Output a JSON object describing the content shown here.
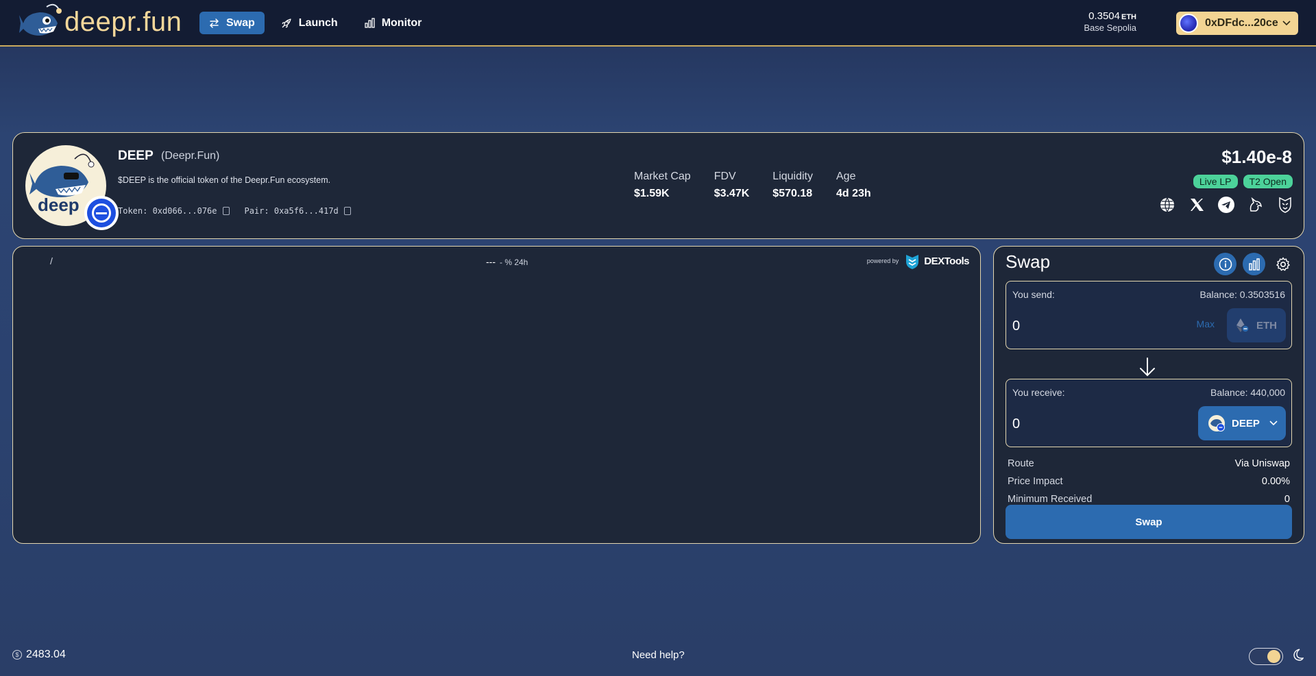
{
  "header": {
    "logo_text": "deepr.fun",
    "nav": [
      {
        "label": "Swap",
        "icon": "swap-arrows-icon",
        "active": true
      },
      {
        "label": "Launch",
        "icon": "rocket-icon",
        "active": false
      },
      {
        "label": "Monitor",
        "icon": "bar-chart-icon",
        "active": false
      }
    ],
    "balance_amount": "0.3504",
    "balance_unit": "ETH",
    "network": "Base Sepolia",
    "wallet_address": "0xDFdc...20ce"
  },
  "token": {
    "symbol": "DEEP",
    "name": "(Deepr.Fun)",
    "logo_text": "deep",
    "description": "$DEEP is the official token of the Deepr.Fun ecosystem.",
    "token_address": "Token: 0xd066...076e",
    "pair_address": "Pair: 0xa5f6...417d",
    "stats": [
      {
        "label": "Market Cap",
        "value": "$1.59K"
      },
      {
        "label": "FDV",
        "value": "$3.47K"
      },
      {
        "label": "Liquidity",
        "value": "$570.18"
      },
      {
        "label": "Age",
        "value": "4d 23h"
      }
    ],
    "price": "$1.40e-8",
    "badges": [
      "Live LP",
      "T2 Open"
    ],
    "socials": [
      "globe-icon",
      "x-twitter-icon",
      "telegram-icon",
      "unicorn-icon",
      "dextools-icon"
    ]
  },
  "chart": {
    "pair_label": "/",
    "price": "---",
    "change": "- % 24h",
    "powered_by": "powered by",
    "provider": "DEXTools"
  },
  "swap": {
    "title": "Swap",
    "send_label": "You send:",
    "send_balance": "Balance: 0.3503516",
    "send_amount": "0",
    "max_label": "Max",
    "send_token": "ETH",
    "receive_label": "You receive:",
    "receive_balance": "Balance: 440,000",
    "receive_amount": "0",
    "receive_token": "DEEP",
    "details": [
      {
        "label": "Route",
        "value": "Via Uniswap"
      },
      {
        "label": "Price Impact",
        "value": "0.00%"
      },
      {
        "label": "Minimum Received",
        "value": "0"
      }
    ],
    "button_label": "Swap"
  },
  "footer": {
    "eth_price": "2483.04",
    "help": "Need help?"
  },
  "colors": {
    "accent": "#2c6bb0",
    "gold": "#f2d493",
    "badge_green": "#4cd29a",
    "panel_bg": "#1e2738",
    "header_bg": "#131c33"
  }
}
